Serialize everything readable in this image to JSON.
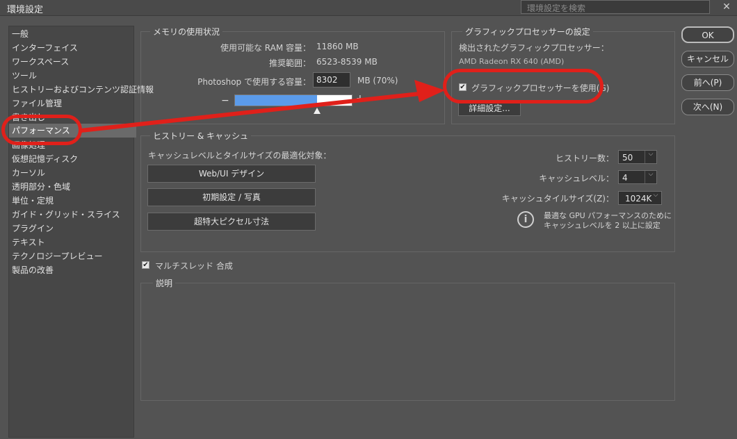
{
  "window": {
    "title": "環境設定",
    "search_placeholder": "環境設定を検索",
    "close": "✕"
  },
  "sidebar": {
    "items": [
      {
        "label": "一般"
      },
      {
        "label": "インターフェイス"
      },
      {
        "label": "ワークスペース"
      },
      {
        "label": "ツール"
      },
      {
        "label": "ヒストリーおよびコンテンツ認証情報"
      },
      {
        "label": "ファイル管理"
      },
      {
        "label": "書き出し"
      },
      {
        "label": "パフォーマンス"
      },
      {
        "label": "画像処理"
      },
      {
        "label": "仮想記憶ディスク"
      },
      {
        "label": "カーソル"
      },
      {
        "label": "透明部分・色域"
      },
      {
        "label": "単位・定規"
      },
      {
        "label": "ガイド・グリッド・スライス"
      },
      {
        "label": "プラグイン"
      },
      {
        "label": "テキスト"
      },
      {
        "label": "テクノロジープレビュー"
      },
      {
        "label": "製品の改善"
      }
    ]
  },
  "memory": {
    "title": "メモリの使用状況",
    "available_label": "使用可能な RAM 容量：",
    "available_value": "11860 MB",
    "range_label": "推奨範囲：",
    "range_value": "6523-8539 MB",
    "use_label": "Photoshop で使用する容量：",
    "use_value": "8302",
    "use_unit": "MB (70%)",
    "minus": "−",
    "plus": "+",
    "slider_fraction": 0.7
  },
  "gpu": {
    "title": "グラフィックプロセッサーの設定",
    "detected_label": "検出されたグラフィックプロセッサー：",
    "detected_value": "AMD Radeon RX 640 (AMD)",
    "use_gpu_label": "グラフィックプロセッサーを使用(G)",
    "use_gpu_checked": true,
    "advanced_button": "詳細設定..."
  },
  "history": {
    "title": "ヒストリー & キャッシュ",
    "optimize_label": "キャッシュレベルとタイルサイズの最適化対象：",
    "preset_buttons": [
      "Web/UI デザイン",
      "初期設定 / 写真",
      "超特大ピクセル寸法"
    ],
    "history_states_label": "ヒストリー数：",
    "history_states_value": "50",
    "cache_levels_label": "キャッシュレベル：",
    "cache_levels_value": "4",
    "tile_size_label": "キャッシュタイルサイズ(Z)：",
    "tile_size_value": "1024K",
    "info_line1": "最適な GPU パフォーマンスのために",
    "info_line2": "キャッシュレベルを 2 以上に設定"
  },
  "multithread": {
    "label": "マルチスレッド 合成",
    "checked": true
  },
  "description": {
    "title": "説明"
  },
  "buttons": {
    "ok": "OK",
    "cancel": "キャンセル",
    "prev": "前へ(P)",
    "next": "次へ(N)"
  },
  "annotation_color": "#e0201a",
  "slider_colors": {
    "blue": "#5b9bea",
    "white": "#ffffff"
  }
}
